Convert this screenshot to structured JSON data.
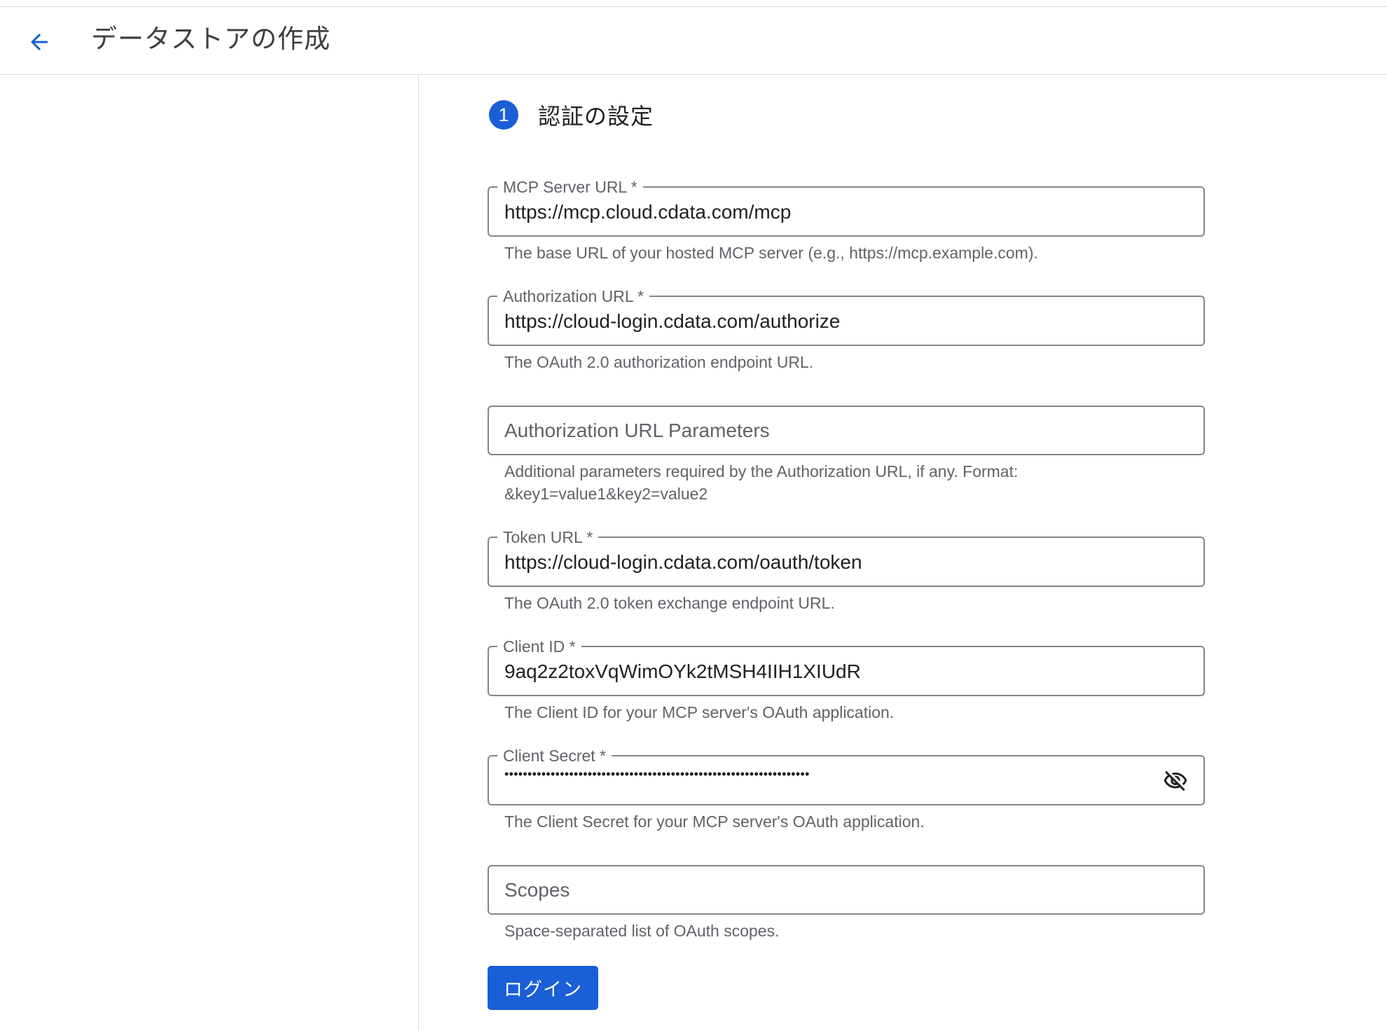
{
  "header": {
    "title": "データストアの作成",
    "back_icon": "arrow-back-icon"
  },
  "step": {
    "number": "1",
    "title": "認証の設定"
  },
  "fields": {
    "mcp_server_url": {
      "label": "MCP Server URL *",
      "value": "https://mcp.cloud.cdata.com/mcp",
      "hint": "The base URL of your hosted MCP server (e.g., https://mcp.example.com)."
    },
    "authorization_url": {
      "label": "Authorization URL *",
      "value": "https://cloud-login.cdata.com/authorize",
      "hint": "The OAuth 2.0 authorization endpoint URL."
    },
    "authorization_url_parameters": {
      "placeholder": "Authorization URL Parameters",
      "hint_line1": "Additional parameters required by the Authorization URL, if any. Format:",
      "hint_line2": "&key1=value1&key2=value2"
    },
    "token_url": {
      "label": "Token URL *",
      "value": "https://cloud-login.cdata.com/oauth/token",
      "hint": "The OAuth 2.0 token exchange endpoint URL."
    },
    "client_id": {
      "label": "Client ID *",
      "value": "9aq2z2toxVqWimOYk2tMSH4IIH1XIUdR",
      "hint": "The Client ID for your MCP server's OAuth application."
    },
    "client_secret": {
      "label": "Client Secret *",
      "masked_value": "••••••••••••••••••••••••••••••••••••••••••••••••••••••••••••••••••",
      "visibility_icon": "visibility-off-icon",
      "hint": "The Client Secret for your MCP server's OAuth application."
    },
    "scopes": {
      "placeholder": "Scopes",
      "hint": "Space-separated list of OAuth scopes."
    }
  },
  "actions": {
    "login_label": "ログイン"
  },
  "colors": {
    "accent": "#1a5fd6",
    "border": "#80868b",
    "hint_text": "#5f6368"
  }
}
